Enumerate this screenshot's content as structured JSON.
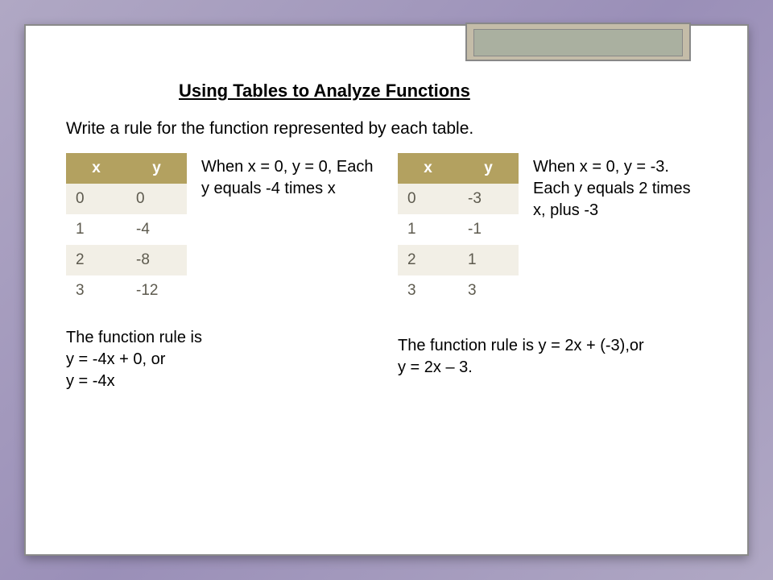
{
  "title": "Using Tables to Analyze Functions",
  "instruction": "Write a rule for the function represented by each table.",
  "left": {
    "headers": {
      "x": "x",
      "y": "y"
    },
    "rows": [
      {
        "x": "0",
        "y": "0"
      },
      {
        "x": "1",
        "y": "-4"
      },
      {
        "x": "2",
        "y": "-8"
      },
      {
        "x": "3",
        "y": "-12"
      }
    ],
    "explain": "When x = 0, y = 0, Each y equals -4 times x",
    "rule": "The function rule is\ny = -4x + 0, or\ny = -4x"
  },
  "right": {
    "headers": {
      "x": "x",
      "y": "y"
    },
    "rows": [
      {
        "x": "0",
        "y": "-3"
      },
      {
        "x": "1",
        "y": "-1"
      },
      {
        "x": "2",
        "y": "1"
      },
      {
        "x": "3",
        "y": "3"
      }
    ],
    "explain": "When x = 0, y = -3. Each y equals 2 times x, plus -3",
    "rule": "The function rule is y = 2x + (-3),or\ny = 2x – 3."
  }
}
